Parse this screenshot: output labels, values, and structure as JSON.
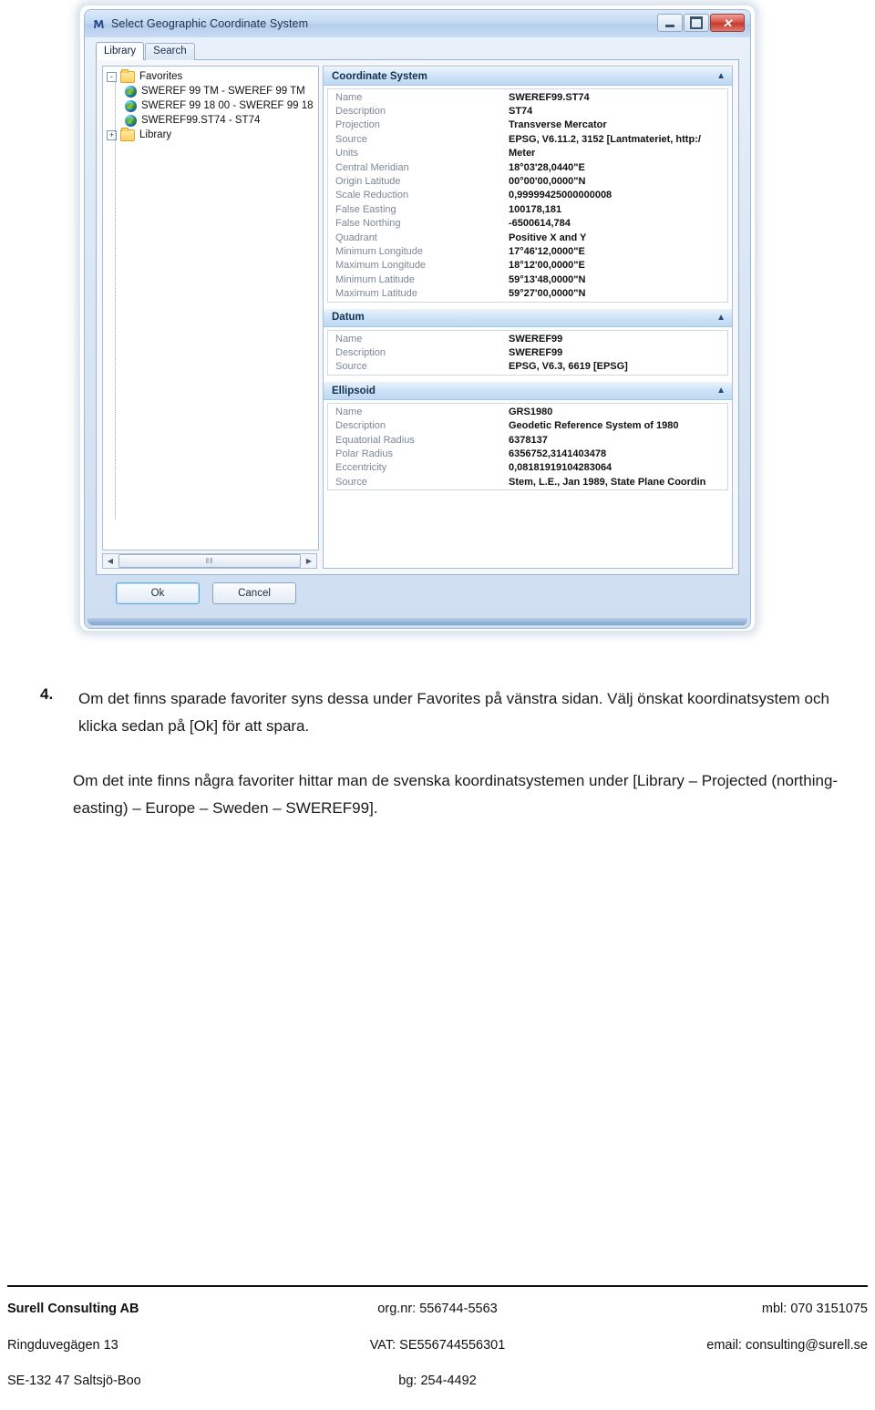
{
  "window": {
    "title": "Select Geographic Coordinate System",
    "app_icon": "application-icon",
    "controls": {
      "minimize": "minimize-icon",
      "maximize": "maximize-icon",
      "close": "close-icon"
    },
    "tabs": [
      {
        "label": "Library",
        "active": true
      },
      {
        "label": "Search",
        "active": false
      }
    ],
    "tree": [
      {
        "level": 1,
        "icon": "folder",
        "toggle": "-",
        "label": "Favorites"
      },
      {
        "level": 2,
        "icon": "globe",
        "toggle": "",
        "label": "SWEREF 99 TM - SWEREF 99 TM"
      },
      {
        "level": 2,
        "icon": "globe",
        "toggle": "",
        "label": "SWEREF 99 18 00 - SWEREF 99 18"
      },
      {
        "level": 2,
        "icon": "globe",
        "toggle": "",
        "label": "SWEREF99.ST74 - ST74"
      },
      {
        "level": 1,
        "icon": "folder",
        "toggle": "+",
        "label": "Library"
      }
    ],
    "scrollbar": {
      "left_arrow": "◀",
      "right_arrow": "▶",
      "grip": "‖‖"
    },
    "sections": [
      {
        "title": "Coordinate System",
        "chevron": "▲",
        "rows": [
          {
            "key": "Name",
            "value": "SWEREF99.ST74"
          },
          {
            "key": "Description",
            "value": "ST74"
          },
          {
            "key": "Projection",
            "value": "Transverse Mercator"
          },
          {
            "key": "Source",
            "value": "EPSG, V6.11.2, 3152 [Lantmateriet, http:/"
          },
          {
            "key": "Units",
            "value": "Meter"
          },
          {
            "key": "Central Meridian",
            "value": "18°03'28,0440\"E"
          },
          {
            "key": "Origin Latitude",
            "value": "00°00'00,0000\"N"
          },
          {
            "key": "Scale Reduction",
            "value": "0,99999425000000008"
          },
          {
            "key": "False Easting",
            "value": "100178,181"
          },
          {
            "key": "False Northing",
            "value": "-6500614,784"
          },
          {
            "key": "Quadrant",
            "value": "Positive X and Y"
          },
          {
            "key": "Minimum Longitude",
            "value": "17°46'12,0000\"E"
          },
          {
            "key": "Maximum Longitude",
            "value": "18°12'00,0000\"E"
          },
          {
            "key": "Minimum Latitude",
            "value": "59°13'48,0000\"N"
          },
          {
            "key": "Maximum Latitude",
            "value": "59°27'00,0000\"N"
          }
        ]
      },
      {
        "title": "Datum",
        "chevron": "▲",
        "rows": [
          {
            "key": "Name",
            "value": "SWEREF99"
          },
          {
            "key": "Description",
            "value": "SWEREF99"
          },
          {
            "key": "Source",
            "value": "EPSG, V6.3, 6619 [EPSG]"
          }
        ]
      },
      {
        "title": "Ellipsoid",
        "chevron": "▲",
        "rows": [
          {
            "key": "Name",
            "value": "GRS1980"
          },
          {
            "key": "Description",
            "value": "Geodetic Reference System of 1980"
          },
          {
            "key": "Equatorial Radius",
            "value": "6378137"
          },
          {
            "key": "Polar Radius",
            "value": "6356752,3141403478"
          },
          {
            "key": "Eccentricity",
            "value": "0,08181919104283064"
          },
          {
            "key": "Source",
            "value": "Stem, L.E., Jan 1989, State Plane Coordin"
          }
        ]
      }
    ],
    "buttons": {
      "ok": "Ok",
      "cancel": "Cancel"
    }
  },
  "document": {
    "item_number": "4.",
    "paragraph1": "Om det finns sparade favoriter syns dessa under Favorites på vänstra sidan. Välj önskat koordinatsystem och klicka sedan på [Ok] för att spara.",
    "paragraph2": "Om det inte finns några favoriter hittar man de svenska koordinatsystemen under [Library – Projected (northing-easting) – Europe – Sweden – SWEREF99]."
  },
  "footer": {
    "row1": {
      "left": "Surell Consulting AB",
      "center": "org.nr: 556744-5563",
      "right": "mbl: 070 3151075"
    },
    "row2": {
      "left": "Ringduvegägen 13",
      "center": "VAT: SE556744556301",
      "right": "email: consulting@surell.se"
    },
    "row3": {
      "left": "SE-132 47 Saltsjö-Boo",
      "center": "bg: 254-4492",
      "right": ""
    }
  },
  "colors": {
    "titlebar": "#c3d9f2",
    "close_button": "#d9544a",
    "section_header": "#cfe3f7",
    "folder": "#fdd063",
    "accent_border": "#9bb3cd"
  }
}
